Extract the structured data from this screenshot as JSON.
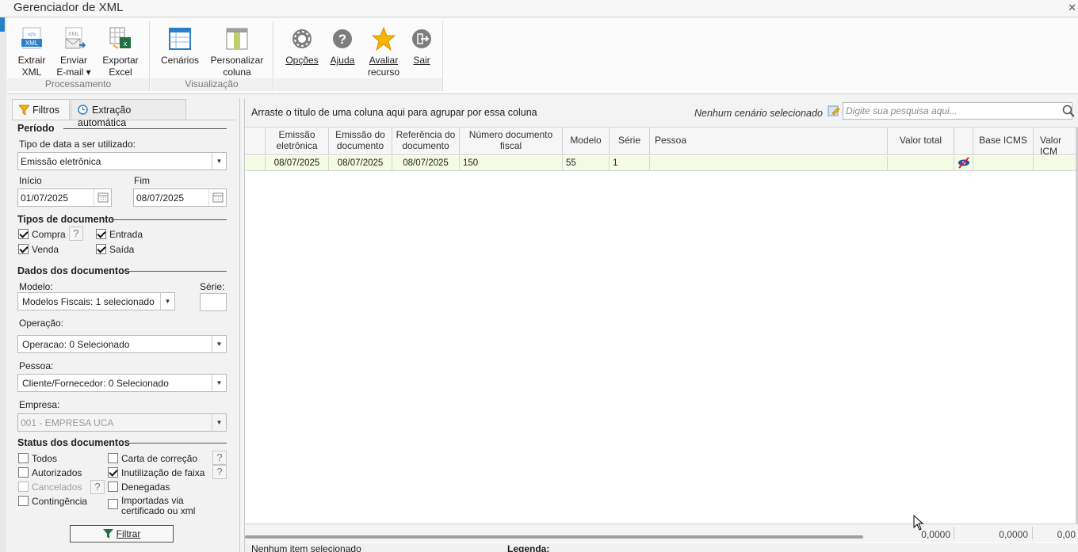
{
  "window": {
    "title": "Gerenciador de XML",
    "close_glyph": "✕"
  },
  "ribbon": {
    "groups": [
      {
        "label": "Processamento"
      },
      {
        "label": "Visualização"
      },
      {
        "label": ""
      }
    ],
    "buttons": [
      {
        "line1": "Extrair",
        "line2": "XML",
        "icon": "xml-file-icon"
      },
      {
        "line1": "Enviar",
        "line2": "E-mail ▾",
        "icon": "email-xml-icon"
      },
      {
        "line1": "Exportar",
        "line2": "Excel",
        "icon": "excel-export-icon"
      },
      {
        "line1": "Cenários",
        "line2": "",
        "icon": "table-layout-icon"
      },
      {
        "line1": "Personalizar",
        "line2": "coluna",
        "icon": "column-customize-icon"
      },
      {
        "line1": "Opções",
        "line2": "",
        "icon": "gear-icon"
      },
      {
        "line1": "Ajuda",
        "line2": "",
        "icon": "help-icon"
      },
      {
        "line1": "Avaliar",
        "line2": "recurso",
        "icon": "star-icon"
      },
      {
        "line1": "Sair",
        "line2": "",
        "icon": "exit-icon"
      }
    ]
  },
  "tabs": [
    {
      "label": "Filtros",
      "icon": "funnel-icon"
    },
    {
      "label": "Extração automática",
      "icon": "clock-icon"
    }
  ],
  "filters": {
    "periodo": {
      "title": "Período",
      "date_type_label": "Tipo de data a ser utilizado:",
      "date_type_value": "Emissão eletrônica",
      "start_label": "Início",
      "start_value": "01/07/2025",
      "end_label": "Fim",
      "end_value": "08/07/2025"
    },
    "tipos": {
      "title": "Tipos de documento",
      "items": [
        {
          "label": "Compra",
          "checked": true
        },
        {
          "label": "Entrada",
          "checked": true
        },
        {
          "label": "Venda",
          "checked": true
        },
        {
          "label": "Saída",
          "checked": true
        }
      ]
    },
    "dados": {
      "title": "Dados dos documentos",
      "modelo_label": "Modelo:",
      "modelo_value": "Modelos Fiscais: 1 selecionado",
      "serie_label": "Série:",
      "serie_value": "",
      "operacao_label": "Operação:",
      "operacao_value": "Operacao: 0 Selecionado",
      "pessoa_label": "Pessoa:",
      "pessoa_value": "Cliente/Fornecedor: 0 Selecionado",
      "empresa_label": "Empresa:",
      "empresa_value": "001 - EMPRESA UCA"
    },
    "status": {
      "title": "Status dos documentos",
      "items": [
        {
          "label": "Todos",
          "checked": false
        },
        {
          "label": "Carta de correção",
          "checked": false
        },
        {
          "label": "Autorizados",
          "checked": false
        },
        {
          "label": "Inutilização de faixa",
          "checked": true
        },
        {
          "label": "Cancelados",
          "checked": false,
          "disabled": true
        },
        {
          "label": "Denegadas",
          "checked": false
        },
        {
          "label": "Contingência",
          "checked": false
        },
        {
          "label": "Importadas via",
          "checked": false
        },
        {
          "label": "certificado ou xml"
        }
      ]
    },
    "help_glyph": "?",
    "filter_button": "Filtrar"
  },
  "grid": {
    "group_hint": "Arraste o título de uma coluna aqui para agrupar por essa coluna",
    "scenario_text": "Nenhum cenário selecionado",
    "search_placeholder": "Digite sua pesquisa aqui...",
    "columns": [
      {
        "l1": "Emissão",
        "l2": "eletrônica"
      },
      {
        "l1": "Emissão do",
        "l2": "documento"
      },
      {
        "l1": "Referência do",
        "l2": "documento"
      },
      {
        "l1": "Número documento",
        "l2": "fiscal"
      },
      {
        "l1": "Modelo",
        "l2": ""
      },
      {
        "l1": "Série",
        "l2": ""
      },
      {
        "l1": "Pessoa",
        "l2": ""
      },
      {
        "l1": "Valor total",
        "l2": ""
      },
      {
        "l1": "",
        "l2": ""
      },
      {
        "l1": "Base ICMS",
        "l2": ""
      },
      {
        "l1": "Valor ICM",
        "l2": ""
      }
    ],
    "rows": [
      {
        "emissao_eletronica": "08/07/2025",
        "emissao_documento": "08/07/2025",
        "referencia": "08/07/2025",
        "numero": "150",
        "modelo": "55",
        "serie": "1",
        "pessoa": "",
        "valor_total": "",
        "flag_icon": "hidden-eye-icon",
        "base_icms": "",
        "valor_icms": ""
      }
    ],
    "totals": {
      "valor_total": "0,0000",
      "base_icms": "0,0000",
      "valor_icms": "0,00"
    },
    "status_text": "Nenhum item selecionado",
    "legend_label": "Legenda:"
  },
  "colors": {
    "accent_blue": "#2a7fc9",
    "row_highlight": "#f4fbe5",
    "excel_green": "#1e7145",
    "star": "#f4b400"
  }
}
